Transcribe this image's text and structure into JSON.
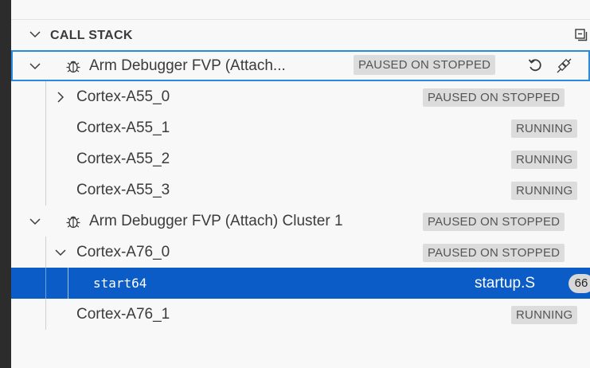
{
  "panel": {
    "title": "CALL STACK"
  },
  "sessions": [
    {
      "name": "Arm Debugger FVP (Attach...",
      "status": "PAUSED ON STOPPED",
      "threads": [
        {
          "name": "Cortex-A55_0",
          "status": "PAUSED ON STOPPED",
          "expanded": false
        },
        {
          "name": "Cortex-A55_1",
          "status": "RUNNING"
        },
        {
          "name": "Cortex-A55_2",
          "status": "RUNNING"
        },
        {
          "name": "Cortex-A55_3",
          "status": "RUNNING"
        }
      ]
    },
    {
      "name": "Arm Debugger FVP (Attach) Cluster 1",
      "status": "PAUSED ON STOPPED",
      "threads": [
        {
          "name": "Cortex-A76_0",
          "status": "PAUSED ON STOPPED",
          "expanded": true,
          "frames": [
            {
              "function": "start64",
              "file": "startup.S",
              "line": "66"
            }
          ]
        },
        {
          "name": "Cortex-A76_1",
          "status": "RUNNING"
        }
      ]
    }
  ],
  "icons": {
    "collapse_all": "collapse-all-icon",
    "restart": "restart-icon",
    "disconnect": "disconnect-icon",
    "session": "bug-icon",
    "chevron_down": "chevron-down-icon",
    "chevron_right": "chevron-right-icon"
  },
  "colors": {
    "selection": "#0b5cc7",
    "focus_border": "#2a8ae0",
    "badge_bg": "#dcdcdc"
  }
}
